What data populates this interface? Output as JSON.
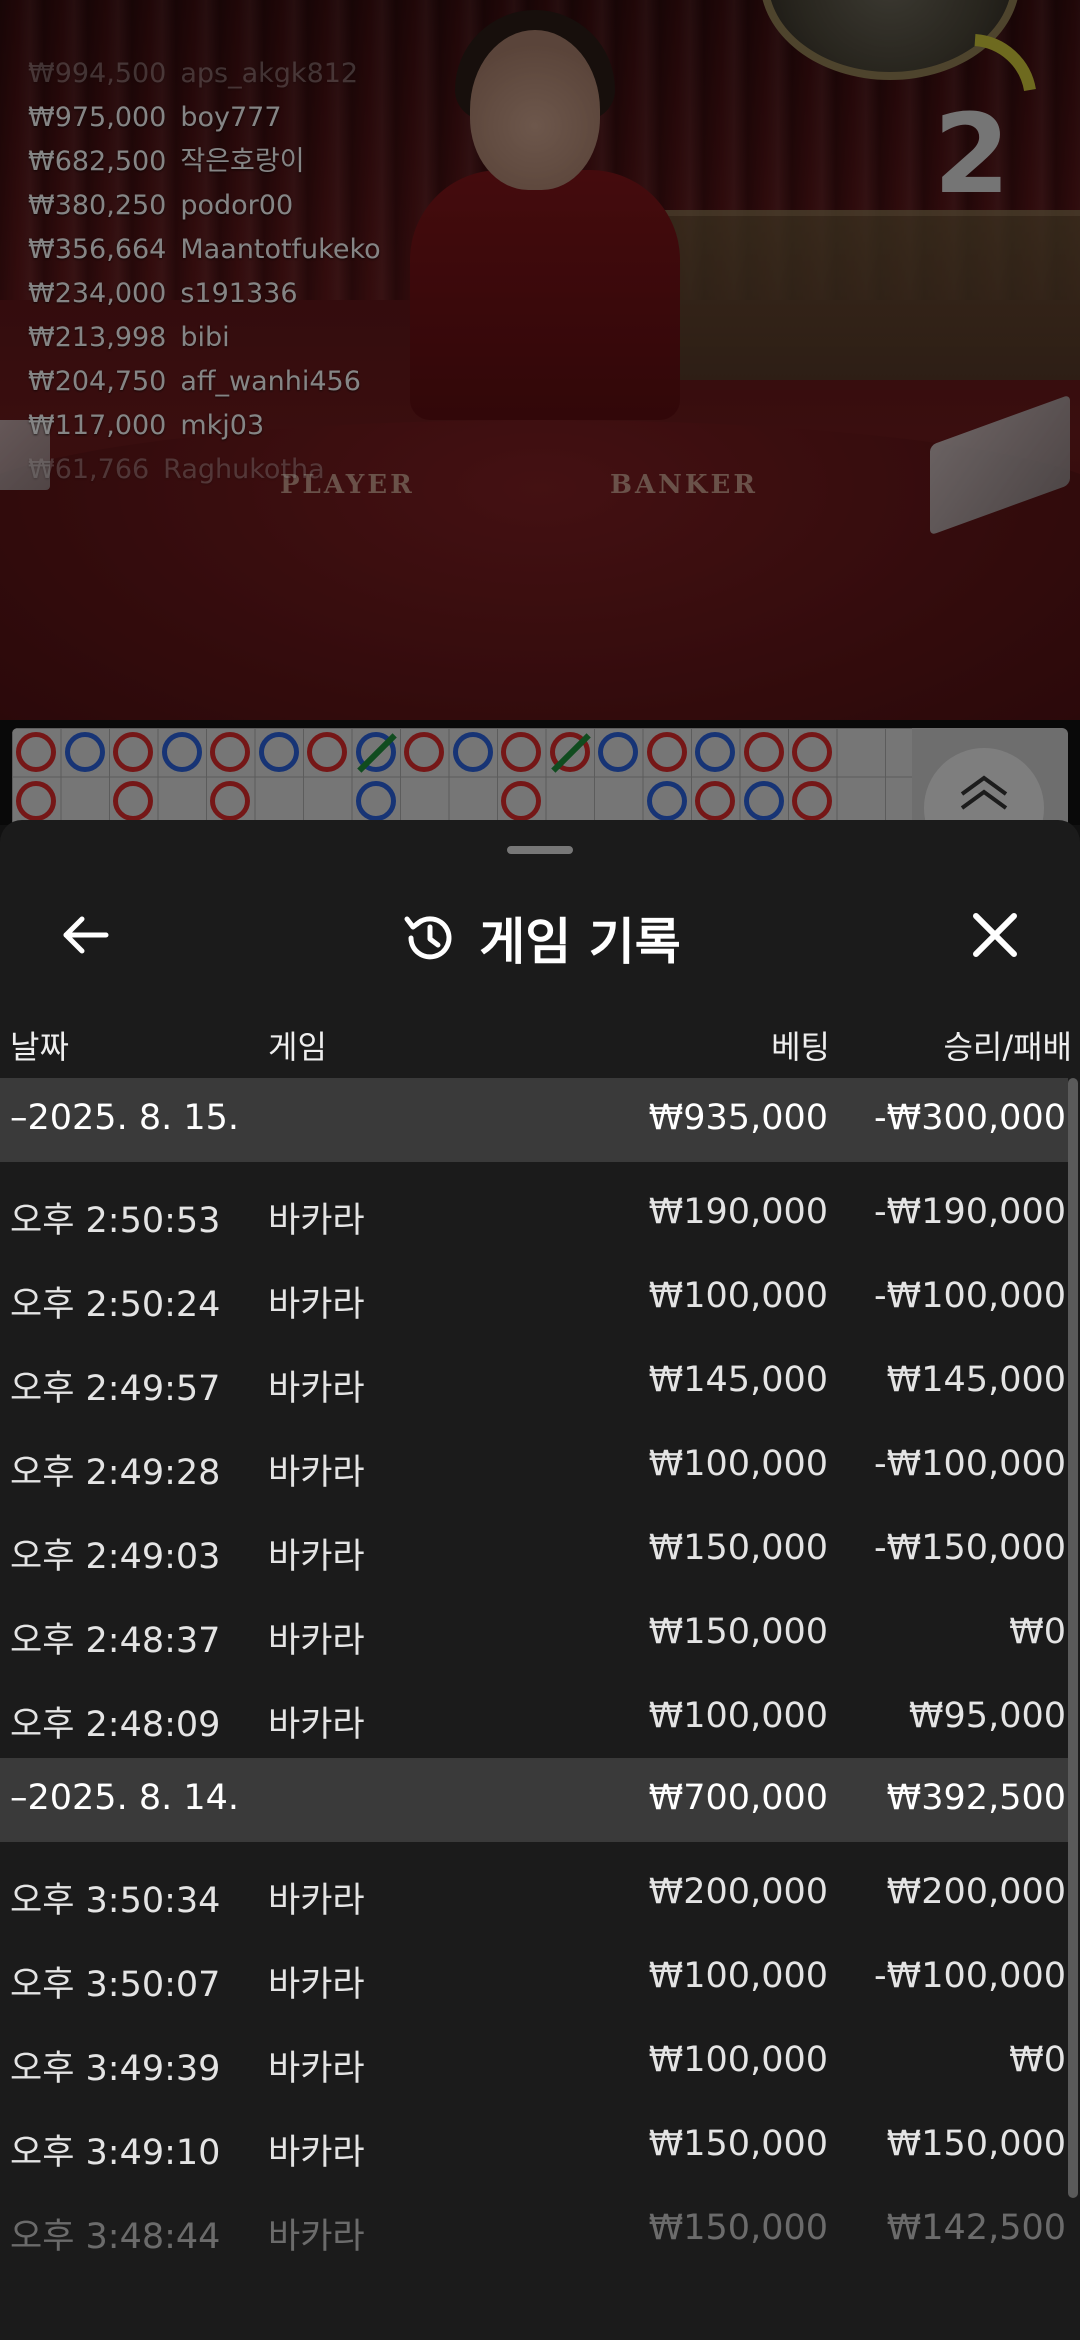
{
  "live_bets": [
    {
      "amount": "₩994,500",
      "user": "aps_akgk812"
    },
    {
      "amount": "₩975,000",
      "user": "boy777"
    },
    {
      "amount": "₩682,500",
      "user": "작은호랑이"
    },
    {
      "amount": "₩380,250",
      "user": "podor00"
    },
    {
      "amount": "₩356,664",
      "user": "Maantotfukeko"
    },
    {
      "amount": "₩234,000",
      "user": "s191336"
    },
    {
      "amount": "₩213,998",
      "user": "bibi"
    },
    {
      "amount": "₩204,750",
      "user": "aff_wanhi456"
    },
    {
      "amount": "₩117,000",
      "user": "mkj03"
    },
    {
      "amount": "₩61,766",
      "user": "Raghukotha"
    }
  ],
  "countdown": "2",
  "table_labels": {
    "player": "PLAYER",
    "banker": "BANKER"
  },
  "colors": {
    "banker": "#d62b2b",
    "player": "#2a5fd6",
    "tie": "#1e8a3a"
  },
  "sheet": {
    "title": "게임 기록",
    "icons": {
      "back": "arrow-left-icon",
      "history": "history-icon",
      "close": "close-icon"
    }
  },
  "columns": {
    "date": "날짜",
    "game": "게임",
    "bet": "베팅",
    "result": "승리/패배"
  },
  "days": [
    {
      "date": "–2025. 8. 15.",
      "total_bet": "₩935,000",
      "total_result": "-₩300,000",
      "records": [
        {
          "time": "오후 2:50:53",
          "game": "바카라",
          "bet": "₩190,000",
          "result": "-₩190,000"
        },
        {
          "time": "오후 2:50:24",
          "game": "바카라",
          "bet": "₩100,000",
          "result": "-₩100,000"
        },
        {
          "time": "오후 2:49:57",
          "game": "바카라",
          "bet": "₩145,000",
          "result": "₩145,000"
        },
        {
          "time": "오후 2:49:28",
          "game": "바카라",
          "bet": "₩100,000",
          "result": "-₩100,000"
        },
        {
          "time": "오후 2:49:03",
          "game": "바카라",
          "bet": "₩150,000",
          "result": "-₩150,000"
        },
        {
          "time": "오후 2:48:37",
          "game": "바카라",
          "bet": "₩150,000",
          "result": "₩0"
        },
        {
          "time": "오후 2:48:09",
          "game": "바카라",
          "bet": "₩100,000",
          "result": "₩95,000"
        }
      ]
    },
    {
      "date": "–2025. 8. 14.",
      "total_bet": "₩700,000",
      "total_result": "₩392,500",
      "records": [
        {
          "time": "오후 3:50:34",
          "game": "바카라",
          "bet": "₩200,000",
          "result": "₩200,000"
        },
        {
          "time": "오후 3:50:07",
          "game": "바카라",
          "bet": "₩100,000",
          "result": "-₩100,000"
        },
        {
          "time": "오후 3:49:39",
          "game": "바카라",
          "bet": "₩100,000",
          "result": "₩0"
        },
        {
          "time": "오후 3:49:10",
          "game": "바카라",
          "bet": "₩150,000",
          "result": "₩150,000"
        },
        {
          "time": "오후 3:48:44",
          "game": "바카라",
          "bet": "₩150,000",
          "result": "₩142,500"
        }
      ]
    }
  ]
}
